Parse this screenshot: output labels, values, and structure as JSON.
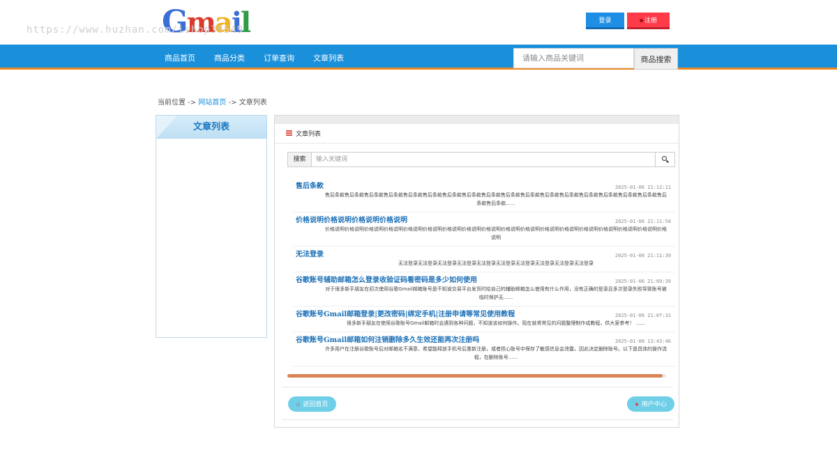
{
  "header": {
    "logo": {
      "g": "G",
      "m": "m",
      "a": "a",
      "i": "i",
      "l": "l"
    },
    "watermark": "https://www.huzhan.com/ishop39549",
    "login_label": "登录",
    "register_label": "注册"
  },
  "nav": {
    "items": [
      "商品首页",
      "商品分类",
      "订单查询",
      "文章列表"
    ],
    "search_placeholder": "请输入商品关键词",
    "search_button": "商品搜索"
  },
  "breadcrumb": {
    "prefix": "当前位置 ->",
    "home": "网站首页",
    "sep": "->",
    "current": "文章列表"
  },
  "sidebar": {
    "title": "文章列表"
  },
  "panel": {
    "title": "文章列表",
    "search_label": "搜索",
    "search_placeholder": "输入关键词"
  },
  "articles": [
    {
      "title": "售后条款",
      "date": "2025-01-06 21:12:11",
      "excerpt": "售后条款售后条款售后条款售后条款售后条款售后条款售后条款售后条款售后条款售后条款售后条款售后条款售后条款售后条款售后条款售后条款售后条款售后条款售后条款......"
    },
    {
      "title": "价格说明价格说明价格说明价格说明",
      "date": "2025-01-06 21:11:54",
      "excerpt": "价格说明价格说明价格说明价格说明价格说明价格说明价格说明价格说明价格说明价格说明价格说明价格说明价格说明价格说明价格说明价格说明价格说明价格说明"
    },
    {
      "title": "无法登录",
      "date": "2025-01-06 21:11:39",
      "excerpt": "无法登录无法登录无法登录无法登录无法登录无法登录无法登录无法登录无法登录无法登录"
    },
    {
      "title": "谷歌账号辅助邮箱怎么登录收验证码看密码是多少如何使用",
      "date": "2025-01-06 21:09:39",
      "excerpt": "对于很多新手朋友在初次使用谷歌Gmail邮箱账号是不知道交易平台发货时给自己的辅助邮箱怎么使用有什么作用，没有正确的登录且多次登录失败导致账号被临时保护无......"
    },
    {
      "title": "谷歌账号Gmail邮箱登录|更改密码|绑定手机|注册申请等常见使用教程",
      "date": "2025-01-06 21:07:31",
      "excerpt": "很多新手朋友在使用谷歌账号Gmail邮箱时会遇到各种问题，不知道该如何操作。现在就将常见的问题整理制作成教程，供大家参考！ ......"
    },
    {
      "title": "谷歌账号Gmail邮箱如何注销删除多久生效还能再次注册吗",
      "date": "2025-01-06 13:43:46",
      "excerpt": "许多用户在注册谷歌账号后对邮箱名不满意，希望能释放手机号后重新注册，或者担心账号中保存了敏感信息会泄露，因此决定删除账号。以下是具体的操作流程，在删除账号......"
    }
  ],
  "scroll_progress": 0.99,
  "footer_buttons": {
    "home": "返回首页",
    "user": "用户中心"
  },
  "colors": {
    "nav_bg": "#1a90db",
    "nav_border": "#f08a24",
    "login": "#1f8fe5",
    "register": "#ff3b4a",
    "link": "#1a6fb7",
    "pill": "#6fcfe8",
    "progress": "#d98455"
  }
}
